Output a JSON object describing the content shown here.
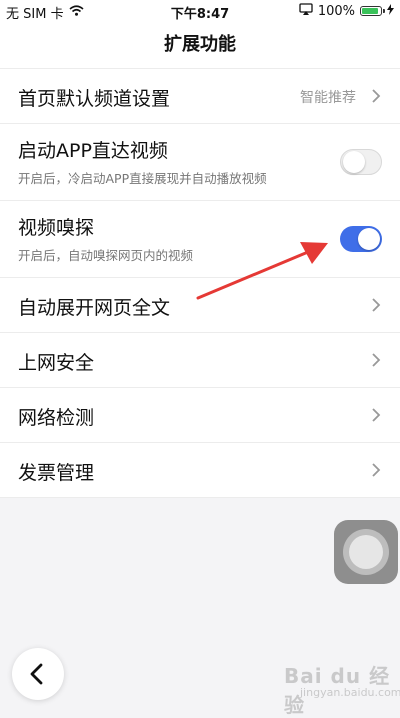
{
  "status_bar": {
    "carrier": "无 SIM 卡",
    "time": "下午8:47",
    "battery_percent": "100%",
    "battery_level": 1.0
  },
  "header": {
    "title": "扩展功能"
  },
  "settings": {
    "home_channel": {
      "label": "首页默认频道设置",
      "value": "智能推荐"
    },
    "app_direct_video": {
      "label": "启动APP直达视频",
      "description": "开启后，冷启动APP直接展现并自动播放视频",
      "enabled": false
    },
    "video_sniff": {
      "label": "视频嗅探",
      "description": "开启后，自动嗅探网页内的视频",
      "enabled": true
    },
    "auto_expand": {
      "label": "自动展开网页全文"
    },
    "web_security": {
      "label": "上网安全"
    },
    "network_check": {
      "label": "网络检测"
    },
    "invoice": {
      "label": "发票管理"
    }
  },
  "colors": {
    "toggle_on": "#3f6ee8",
    "arrow": "#e53935",
    "battery": "#3ac25a"
  },
  "watermark": {
    "brand": "Bai du 经验",
    "url": "jingyan.baidu.com"
  }
}
